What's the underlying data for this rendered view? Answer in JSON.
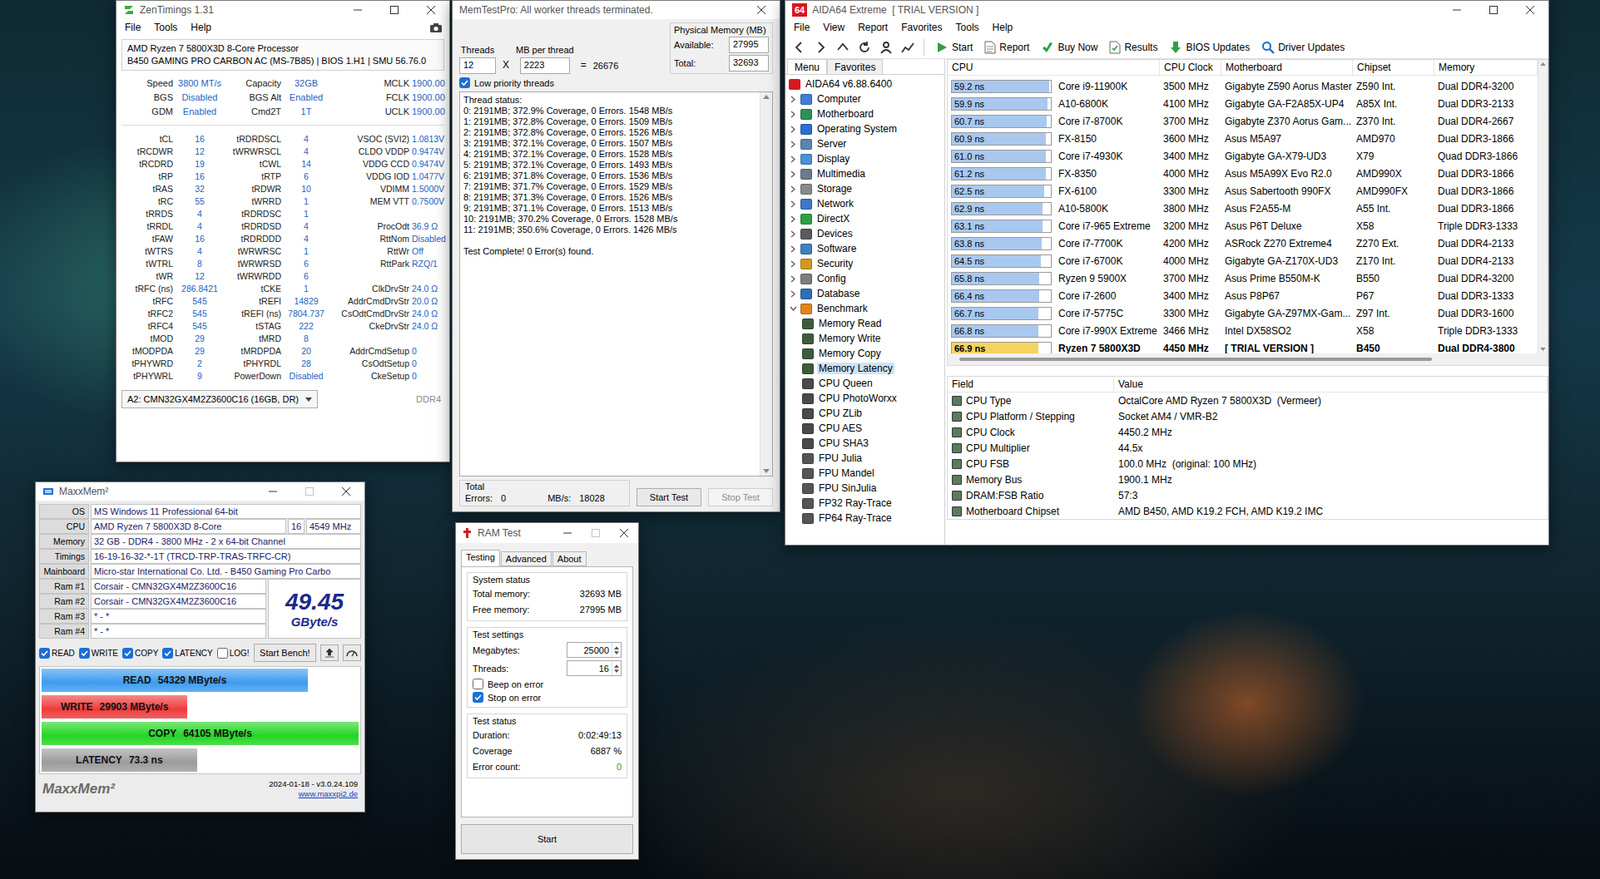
{
  "zentimings": {
    "title": "ZenTimings 1.31",
    "max_disabled": false,
    "menu": [
      "File",
      "Tools",
      "Help"
    ],
    "info": [
      "AMD Ryzen 7 5800X3D 8-Core Processor",
      "B450 GAMING PRO CARBON AC (MS-7B85) | BIOS 1.H1 | SMU 56.76.0"
    ],
    "summary": [
      [
        "Speed",
        "3800 MT/s",
        "Capacity",
        "32GB",
        "MCLK",
        "1900.00"
      ],
      [
        "BGS",
        "Disabled",
        "BGS Alt",
        "Enabled",
        "FCLK",
        "1900.00"
      ],
      [
        "GDM",
        "Enabled",
        "Cmd2T",
        "1T",
        "UCLK",
        "1900.00"
      ]
    ],
    "timings": [
      [
        "tCL",
        "16",
        "tRDRDSCL",
        "4",
        "VSOC (SVI2)",
        "1.0813V"
      ],
      [
        "tRCDWR",
        "12",
        "tWRWRSCL",
        "4",
        "CLDO VDDP",
        "0.9474V"
      ],
      [
        "tRCDRD",
        "19",
        "tCWL",
        "14",
        "VDDG CCD",
        "0.9474V"
      ],
      [
        "tRP",
        "16",
        "tRTP",
        "6",
        "VDDG IOD",
        "1.0477V"
      ],
      [
        "tRAS",
        "32",
        "tRDWR",
        "10",
        "VDIMM",
        "1.5000V"
      ],
      [
        "tRC",
        "55",
        "tWRRD",
        "1",
        "MEM VTT",
        "0.7500V"
      ],
      [
        "tRRDS",
        "4",
        "tRDRDSC",
        "1"
      ],
      [
        "tRRDL",
        "4",
        "tRDRDSD",
        "4",
        "ProcOdt",
        "36.9 Ω"
      ],
      [
        "tFAW",
        "16",
        "tRDRDDD",
        "4",
        "RttNom",
        "Disabled"
      ],
      [
        "tWTRS",
        "4",
        "tWRWRSC",
        "1",
        "RttWr",
        "Off"
      ],
      [
        "tWTRL",
        "8",
        "tWRWRSD",
        "6",
        "RttPark",
        "RZQ/1"
      ],
      [
        "tWR",
        "12",
        "tWRWRDD",
        "6"
      ],
      [
        "tRFC (ns)",
        "286.8421",
        "tCKE",
        "1",
        "ClkDrvStr",
        "24.0 Ω"
      ],
      [
        "tRFC",
        "545",
        "tREFI",
        "14829",
        "AddrCmdDrvStr",
        "20.0 Ω"
      ],
      [
        "tRFC2",
        "545",
        "tREFI (ns)",
        "7804.737",
        "CsOdtCmdDrvStr",
        "24.0 Ω"
      ],
      [
        "tRFC4",
        "545",
        "tSTAG",
        "222",
        "CkeDrvStr",
        "24.0 Ω"
      ],
      [
        "tMOD",
        "29",
        "tMRD",
        "8"
      ],
      [
        "tMODPDA",
        "29",
        "tMRDPDA",
        "20",
        "AddrCmdSetup",
        "0"
      ],
      [
        "tPHYWRD",
        "2",
        "tPHYRDL",
        "28",
        "CsOdtSetup",
        "0"
      ],
      [
        "tPHYWRL",
        "9",
        "PowerDown",
        "Disabled",
        "CkeSetup",
        "0"
      ]
    ],
    "module": {
      "label": "A2: CMN32GX4M2Z3600C16 (16GB, DR)",
      "type": "DDR4"
    }
  },
  "memtest": {
    "title": "MemTestPro: All worker threads terminated.",
    "threads_label": "Threads",
    "threads": "12",
    "x": "X",
    "mb_label": "MB per thread",
    "mb": "2223",
    "eq": "=",
    "total": "26676",
    "phys_label": "Physical Memory (MB)",
    "available_label": "Available:",
    "available": "27995",
    "total_label": "Total:",
    "total_mem": "32693",
    "low_priority": {
      "label": "Low priority threads",
      "checked": true
    },
    "status_header": "Thread status:",
    "status_lines": [
      "0: 2191MB; 372.9% Coverage, 0 Errors. 1548 MB/s",
      "1: 2191MB; 372.8% Coverage, 0 Errors. 1509 MB/s",
      "2: 2191MB; 372.8% Coverage, 0 Errors. 1526 MB/s",
      "3: 2191MB; 372.1% Coverage, 0 Errors. 1507 MB/s",
      "4: 2191MB; 372.1% Coverage, 0 Errors. 1528 MB/s",
      "5: 2191MB; 372.1% Coverage, 0 Errors. 1493 MB/s",
      "6: 2191MB; 371.8% Coverage, 0 Errors. 1536 MB/s",
      "7: 2191MB; 371.7% Coverage, 0 Errors. 1529 MB/s",
      "8: 2191MB; 371.3% Coverage, 0 Errors. 1526 MB/s",
      "9: 2191MB; 371.1% Coverage, 0 Errors. 1513 MB/s",
      "10: 2191MB; 370.2% Coverage, 0 Errors. 1528 MB/s",
      "11: 2191MB; 350.6% Coverage, 0 Errors. 1426 MB/s"
    ],
    "result": "Test Complete! 0 Error(s) found.",
    "total_group": "Total",
    "errors_label": "Errors:",
    "errors": "0",
    "mbs_label": "MB/s:",
    "mbs": "18028",
    "buttons": [
      {
        "label": "Start Test",
        "disabled": false
      },
      {
        "label": "Stop Test",
        "disabled": true
      }
    ]
  },
  "aida": {
    "logo": "64",
    "title": "AIDA64 Extreme  [ TRIAL VERSION ]",
    "max_disabled": false,
    "menu": [
      "File",
      "View",
      "Report",
      "Favorites",
      "Tools",
      "Help"
    ],
    "toolbar": [
      {
        "label": "Start",
        "kind": "start"
      },
      {
        "label": "Report",
        "kind": "report"
      },
      {
        "label": "Buy Now",
        "kind": "buy"
      },
      {
        "label": "Results",
        "kind": "results"
      },
      {
        "label": "BIOS Updates",
        "kind": "bios"
      },
      {
        "label": "Driver Updates",
        "kind": "driver"
      }
    ],
    "tabs": [
      {
        "label": "Menu",
        "selected": true
      },
      {
        "label": "Favorites",
        "selected": false
      }
    ],
    "tree_root": "AIDA64 v6.88.6400",
    "tree": [
      {
        "label": "Computer",
        "kind": "computer",
        "expanded": false
      },
      {
        "label": "Motherboard",
        "kind": "motherboard",
        "expanded": false
      },
      {
        "label": "Operating System",
        "kind": "os",
        "expanded": false
      },
      {
        "label": "Server",
        "kind": "server",
        "expanded": false
      },
      {
        "label": "Display",
        "kind": "display",
        "expanded": false
      },
      {
        "label": "Multimedia",
        "kind": "multimedia",
        "expanded": false
      },
      {
        "label": "Storage",
        "kind": "storage",
        "expanded": false
      },
      {
        "label": "Network",
        "kind": "network",
        "expanded": false
      },
      {
        "label": "DirectX",
        "kind": "directx",
        "expanded": false
      },
      {
        "label": "Devices",
        "kind": "devices",
        "expanded": false
      },
      {
        "label": "Software",
        "kind": "software",
        "expanded": false
      },
      {
        "label": "Security",
        "kind": "security",
        "expanded": false
      },
      {
        "label": "Config",
        "kind": "config",
        "expanded": false
      },
      {
        "label": "Database",
        "kind": "database",
        "expanded": false
      },
      {
        "label": "Benchmark",
        "kind": "benchmark",
        "expanded": true,
        "children": [
          {
            "label": "Memory Read",
            "kind": "memory",
            "selected": false
          },
          {
            "label": "Memory Write",
            "kind": "memory",
            "selected": false
          },
          {
            "label": "Memory Copy",
            "kind": "memory",
            "selected": false
          },
          {
            "label": "Memory Latency",
            "kind": "memory",
            "selected": true
          },
          {
            "label": "CPU Queen",
            "kind": "cpu",
            "selected": false
          },
          {
            "label": "CPU PhotoWorxx",
            "kind": "cpu",
            "selected": false
          },
          {
            "label": "CPU ZLib",
            "kind": "cpu",
            "selected": false
          },
          {
            "label": "CPU AES",
            "kind": "cpu",
            "selected": false
          },
          {
            "label": "CPU SHA3",
            "kind": "cpu",
            "selected": false
          },
          {
            "label": "FPU Julia",
            "kind": "fpu",
            "selected": false
          },
          {
            "label": "FPU Mandel",
            "kind": "fpu",
            "selected": false
          },
          {
            "label": "FPU SinJulia",
            "kind": "fpu",
            "selected": false
          },
          {
            "label": "FP32 Ray-Trace",
            "kind": "fpu",
            "selected": false
          },
          {
            "label": "FP64 Ray-Trace",
            "kind": "fpu",
            "selected": false
          }
        ]
      }
    ],
    "columns": [
      "CPU",
      "CPU Clock",
      "Motherboard",
      "Chipset",
      "Memory"
    ],
    "rows": [
      {
        "latency": "59.2 ns",
        "level": 0.98,
        "cpu": "Core i9-11900K",
        "clock": "3500 MHz",
        "board": "Gigabyte Z590 Aorus Master",
        "chipset": "Z590 Int.",
        "memory": "Dual DDR4-3200",
        "current": false
      },
      {
        "latency": "59.9 ns",
        "level": 0.97,
        "cpu": "A10-6800K",
        "clock": "4100 MHz",
        "board": "Gigabyte GA-F2A85X-UP4",
        "chipset": "A85X Int.",
        "memory": "Dual DDR3-2133",
        "current": false
      },
      {
        "latency": "60.7 ns",
        "level": 0.96,
        "cpu": "Core i7-8700K",
        "clock": "3700 MHz",
        "board": "Gigabyte Z370 Aorus Gam...",
        "chipset": "Z370 Int.",
        "memory": "Dual DDR4-2667",
        "current": false
      },
      {
        "latency": "60.9 ns",
        "level": 0.95,
        "cpu": "FX-8150",
        "clock": "3600 MHz",
        "board": "Asus M5A97",
        "chipset": "AMD970",
        "memory": "Dual DDR3-1866",
        "current": false
      },
      {
        "latency": "61.0 ns",
        "level": 0.95,
        "cpu": "Core i7-4930K",
        "clock": "3400 MHz",
        "board": "Gigabyte GA-X79-UD3",
        "chipset": "X79",
        "memory": "Quad DDR3-1866",
        "current": false
      },
      {
        "latency": "61.2 ns",
        "level": 0.95,
        "cpu": "FX-8350",
        "clock": "4000 MHz",
        "board": "Asus M5A99X Evo R2.0",
        "chipset": "AMD990X",
        "memory": "Dual DDR3-1866",
        "current": false
      },
      {
        "latency": "62.5 ns",
        "level": 0.93,
        "cpu": "FX-6100",
        "clock": "3300 MHz",
        "board": "Asus Sabertooth 990FX",
        "chipset": "AMD990FX",
        "memory": "Dual DDR3-1866",
        "current": false
      },
      {
        "latency": "62.9 ns",
        "level": 0.92,
        "cpu": "A10-5800K",
        "clock": "3800 MHz",
        "board": "Asus F2A55-M",
        "chipset": "A55 Int.",
        "memory": "Dual DDR3-1866",
        "current": false
      },
      {
        "latency": "63.1 ns",
        "level": 0.92,
        "cpu": "Core i7-965 Extreme",
        "clock": "3200 MHz",
        "board": "Asus P6T Deluxe",
        "chipset": "X58",
        "memory": "Triple DDR3-1333",
        "current": false
      },
      {
        "latency": "63.8 ns",
        "level": 0.91,
        "cpu": "Core i7-7700K",
        "clock": "4200 MHz",
        "board": "ASRock Z270 Extreme4",
        "chipset": "Z270 Ext.",
        "memory": "Dual DDR4-2133",
        "current": false
      },
      {
        "latency": "64.5 ns",
        "level": 0.9,
        "cpu": "Core i7-6700K",
        "clock": "4000 MHz",
        "board": "Gigabyte GA-Z170X-UD3",
        "chipset": "Z170 Int.",
        "memory": "Dual DDR4-2133",
        "current": false
      },
      {
        "latency": "65.8 ns",
        "level": 0.88,
        "cpu": "Ryzen 9 5900X",
        "clock": "3700 MHz",
        "board": "Asus Prime B550M-K",
        "chipset": "B550",
        "memory": "Dual DDR4-3200",
        "current": false
      },
      {
        "latency": "66.4 ns",
        "level": 0.88,
        "cpu": "Core i7-2600",
        "clock": "3400 MHz",
        "board": "Asus P8P67",
        "chipset": "P67",
        "memory": "Dual DDR3-1333",
        "current": false
      },
      {
        "latency": "66.7 ns",
        "level": 0.87,
        "cpu": "Core i7-5775C",
        "clock": "3300 MHz",
        "board": "Gigabyte GA-Z97MX-Gam...",
        "chipset": "Z97 Int.",
        "memory": "Dual DDR3-1600",
        "current": false
      },
      {
        "latency": "66.8 ns",
        "level": 0.87,
        "cpu": "Core i7-990X Extreme",
        "clock": "3466 MHz",
        "board": "Intel DX58SO2",
        "chipset": "X58",
        "memory": "Triple DDR3-1333",
        "current": false
      },
      {
        "latency": "66.9 ns",
        "level": 0.87,
        "cpu": "Ryzen 7 5800X3D",
        "clock": "4450 MHz",
        "board": "[ TRIAL VERSION ]",
        "chipset": "B450",
        "memory": "Dual DDR4-3800",
        "current": true
      }
    ],
    "detail_columns": [
      "Field",
      "Value"
    ],
    "details": [
      {
        "field": "CPU Type",
        "value": "OctalCore AMD Ryzen 7 5800X3D  (Vermeer)"
      },
      {
        "field": "CPU Platform / Stepping",
        "value": "Socket AM4 / VMR-B2"
      },
      {
        "field": "CPU Clock",
        "value": "4450.2 MHz"
      },
      {
        "field": "CPU Multiplier",
        "value": "44.5x"
      },
      {
        "field": "CPU FSB",
        "value": "100.0 MHz  (original: 100 MHz)"
      },
      {
        "field": "Memory Bus",
        "value": "1900.1 MHz"
      },
      {
        "field": "DRAM:FSB Ratio",
        "value": "57:3"
      },
      {
        "field": "Motherboard Chipset",
        "value": "AMD B450, AMD K19.2 FCH, AMD K19.2 IMC"
      }
    ]
  },
  "maxxmem": {
    "title": "MaxxMem²",
    "max_disabled": true,
    "info": [
      {
        "label": "OS",
        "values": [
          "MS Windows 11 Professional 64-bit"
        ]
      },
      {
        "label": "CPU",
        "values": [
          "AMD Ryzen 7 5800X3D 8-Core",
          "16",
          "4549 MHz"
        ]
      },
      {
        "label": "Memory",
        "values": [
          "32 GB - DDR4 - 3800 MHz - 2 x 64-bit Channel"
        ]
      },
      {
        "label": "Timings",
        "values": [
          "16-19-16-32-*-1T (TRCD-TRP-TRAS-TRFC-CR)"
        ]
      },
      {
        "label": "Mainboard",
        "values": [
          "Micro-star International Co. Ltd. - B450 Gaming Pro Carbo"
        ]
      }
    ],
    "ram": [
      {
        "label": "Ram #1",
        "value": "Corsair - CMN32GX4M2Z3600C16"
      },
      {
        "label": "Ram #2",
        "value": "Corsair - CMN32GX4M2Z3600C16"
      },
      {
        "label": "Ram #3",
        "value": "* - *"
      },
      {
        "label": "Ram #4",
        "value": "* - *"
      }
    ],
    "score": "49.45",
    "score_unit": "GByte/s",
    "checks": [
      {
        "label": "READ",
        "checked": true
      },
      {
        "label": "WRITE",
        "checked": true
      },
      {
        "label": "COPY",
        "checked": true
      },
      {
        "label": "LATENCY",
        "checked": true
      },
      {
        "label": "LOG!",
        "checked": false
      }
    ],
    "start": "Start Bench!",
    "bars": [
      {
        "label": "READ",
        "value": "54329 MByte/s",
        "level": 0.84,
        "color": "#3d9cf0"
      },
      {
        "label": "WRITE",
        "value": "29903 MByte/s",
        "level": 0.46,
        "color": "#ee3b3b"
      },
      {
        "label": "COPY",
        "value": "64105 MByte/s",
        "level": 1.0,
        "color": "#22d622"
      },
      {
        "label": "LATENCY",
        "value": "73.3 ns",
        "level": 0.49,
        "color": "#9c9c9c"
      }
    ],
    "logo": "MaxxMem²",
    "version": "2024-01-18 - v3.0.24.109",
    "link": "www.maxxpi2.de"
  },
  "ramtest": {
    "title": "RAM Test",
    "max_disabled": true,
    "tabs": [
      {
        "label": "Testing",
        "selected": true
      },
      {
        "label": "Advanced",
        "selected": false
      },
      {
        "label": "About",
        "selected": false
      }
    ],
    "system_title": "System status",
    "system": [
      {
        "label": "Total memory:",
        "value": "32693 MB"
      },
      {
        "label": "Free memory:",
        "value": "27995 MB"
      }
    ],
    "settings_title": "Test settings",
    "fields": [
      {
        "label": "Megabytes:",
        "value": "25000"
      },
      {
        "label": "Threads:",
        "value": "16"
      }
    ],
    "checks": [
      {
        "label": "Beep on error",
        "checked": false
      },
      {
        "label": "Stop on error",
        "checked": true
      }
    ],
    "status_title": "Test status",
    "status": [
      {
        "label": "Duration:",
        "value": "0:02:49:13",
        "color": "#000000"
      },
      {
        "label": "Coverage",
        "value": "6887 %",
        "color": "#000000"
      },
      {
        "label": "Error count:",
        "value": "0",
        "color": "#1f9a2a"
      }
    ],
    "start": "Start"
  }
}
